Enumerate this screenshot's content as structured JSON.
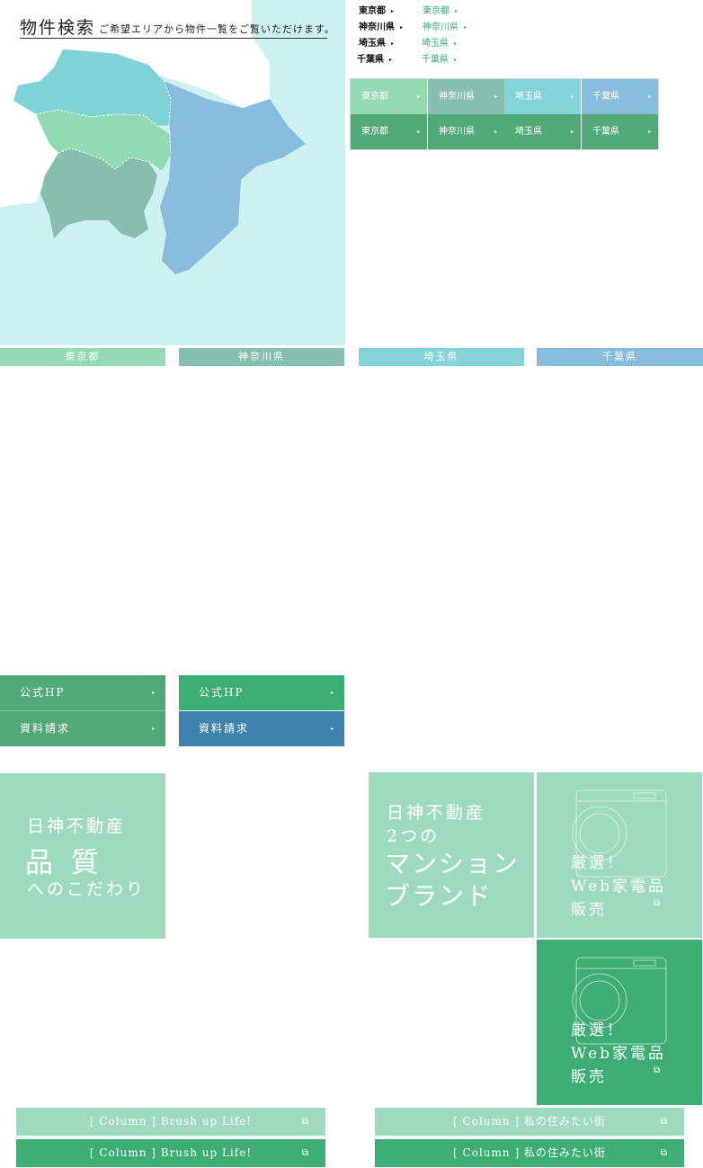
{
  "map": {
    "title": "物件検索",
    "subtitle": "ご希望エリアから物件一覧をご覧いただけます。"
  },
  "text_links": {
    "dark": [
      "東京都",
      "神奈川県",
      "埼玉県",
      "千葉県"
    ],
    "green": [
      "東京都",
      "神奈川県",
      "埼玉県",
      "千葉県"
    ],
    "arrow": "▸"
  },
  "pref_buttons": {
    "row1": [
      "東京都",
      "神奈川県",
      "埼玉県",
      "千葉県"
    ],
    "row2": [
      "東京都",
      "神奈川県",
      "埼玉県",
      "千葉県"
    ],
    "arrow": "▸"
  },
  "label_bars": [
    "東京都",
    "神奈川県",
    "埼玉県",
    "千葉県"
  ],
  "hp_buttons": {
    "col1": [
      "公式HP",
      "資料請求"
    ],
    "col2": [
      "公式HP",
      "資料請求"
    ],
    "arrow": "▸"
  },
  "tiles": {
    "quality": {
      "line1": "日神不動産",
      "line2": "品 質",
      "line3": "へのこだわり"
    },
    "brand": {
      "line1": "日神不動産",
      "line2": "2つの",
      "line3": "マンション",
      "line4": "ブランド"
    },
    "web1": {
      "line1": "厳選！",
      "line2": "Web家電品",
      "line3": "販売"
    },
    "web2": {
      "line1": "厳選！",
      "line2": "Web家電品",
      "line3": "販売"
    }
  },
  "column_bars": {
    "left": [
      "[ Column ] Brush up Life!",
      "[ Column ] Brush up Life!"
    ],
    "right": [
      "[ Column ] 私の住みたい街",
      "[ Column ] 私の住みたい街"
    ]
  },
  "colors": {
    "tokyo": "#96dab4",
    "kanagawa": "#86bfb0",
    "saitama": "#84d3d8",
    "chiba": "#87bcdc",
    "green_dark": "#52aa78",
    "green_bright": "#3dad73",
    "blue_dark": "#3e82ad",
    "sea": "#cdf0f0",
    "pale_green": "#9fdbbf"
  }
}
